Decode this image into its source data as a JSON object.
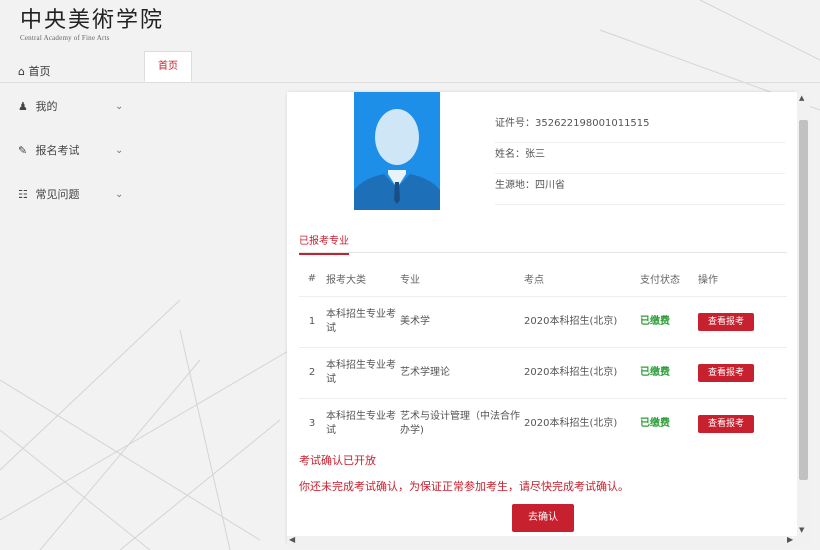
{
  "logo": {
    "main": "中央美術学院",
    "sub": "Central Academy of Fine Arts"
  },
  "topbar": {
    "home_label": "首页",
    "tab_home": "首页"
  },
  "sidebar": {
    "items": [
      {
        "label": "我的",
        "icon": "user-icon"
      },
      {
        "label": "报名考试",
        "icon": "edit-icon"
      },
      {
        "label": "常见问题",
        "icon": "sitemap-icon"
      }
    ]
  },
  "profile": {
    "id_label": "证件号：352622198001011515",
    "name_label": "姓名：张三",
    "origin_label": "生源地：四川省"
  },
  "section": {
    "tab_label": "已报考专业"
  },
  "table": {
    "headers": [
      "#",
      "报考大类",
      "专业",
      "考点",
      "支付状态",
      "操作"
    ],
    "rows": [
      {
        "num": "1",
        "category": "本科招生专业考试",
        "major": "美术学",
        "site": "2020本科招生(北京)",
        "status": "已缴费",
        "action": "查看报考"
      },
      {
        "num": "2",
        "category": "本科招生专业考试",
        "major": "艺术学理论",
        "site": "2020本科招生(北京)",
        "status": "已缴费",
        "action": "查看报考"
      },
      {
        "num": "3",
        "category": "本科招生专业考试",
        "major": "艺术与设计管理（中法合作办学)",
        "site": "2020本科招生(北京)",
        "status": "已缴费",
        "action": "查看报考"
      }
    ]
  },
  "notice": {
    "title": "考试确认已开放",
    "text": "你还未完成考试确认，为保证正常参加考生，请尽快完成考试确认。",
    "confirm_label": "去确认"
  },
  "colors": {
    "accent": "#c7202e",
    "paid": "#2f9e3a",
    "photo_bg": "#1e8fe8"
  }
}
